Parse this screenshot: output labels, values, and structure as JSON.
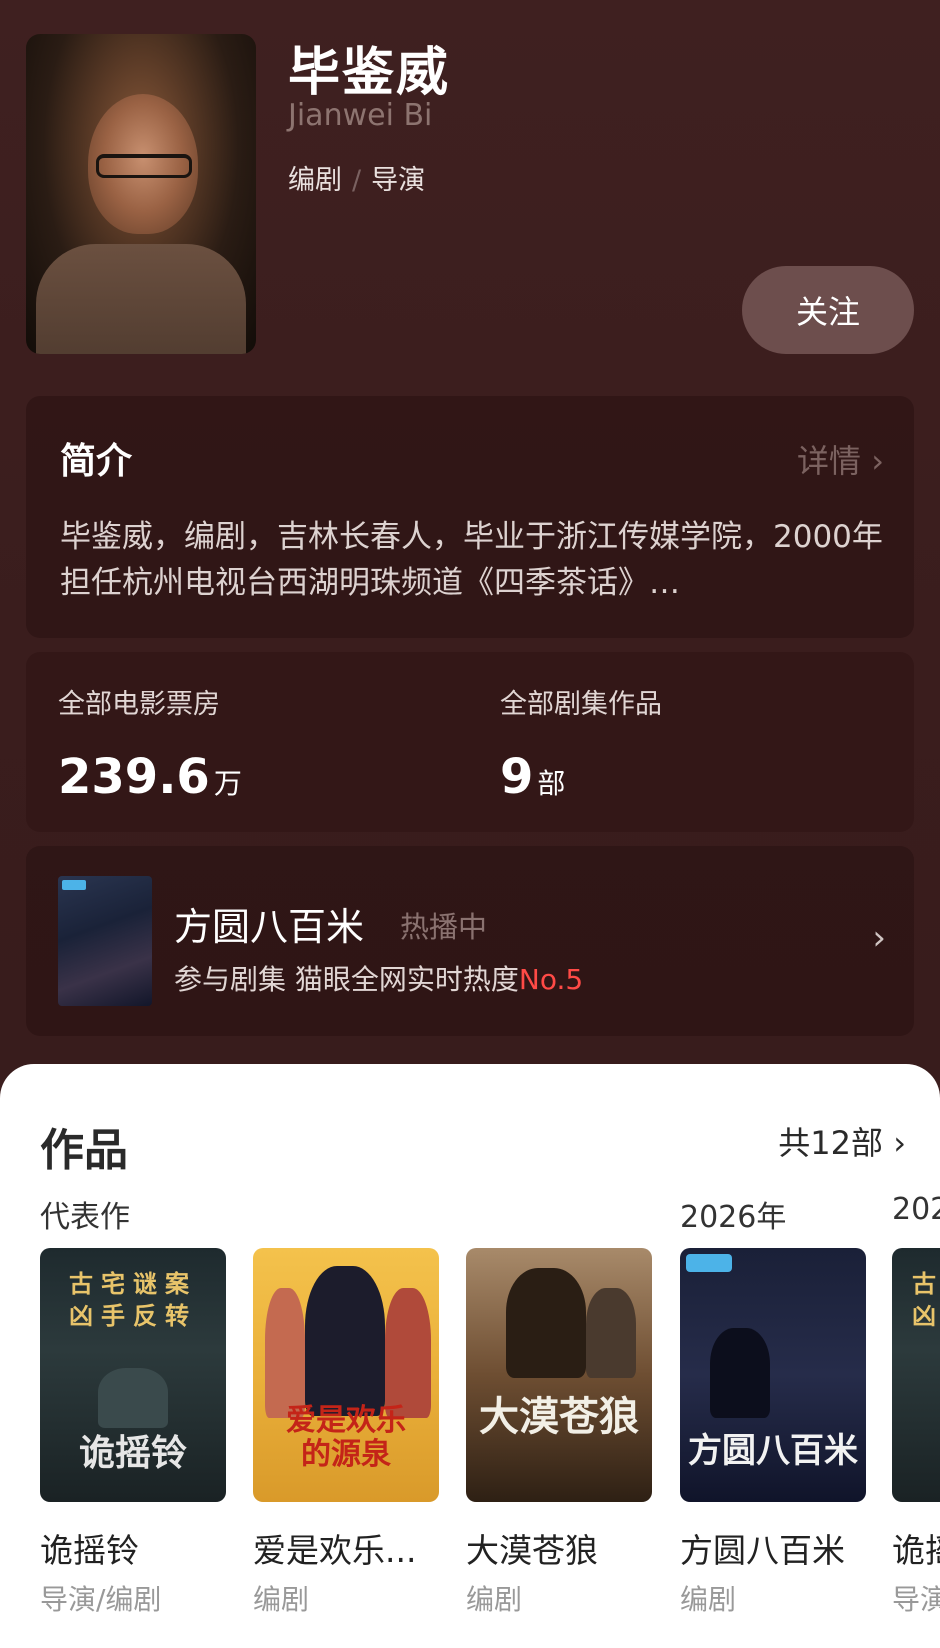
{
  "person": {
    "name": "毕鉴威",
    "english_name": "Jianwei Bi",
    "roles": [
      "编剧",
      "导演"
    ],
    "role_separator": "/",
    "follow_label": "关注"
  },
  "intro": {
    "title": "简介",
    "more_label": "详情",
    "text": "毕鉴威，编剧，吉林长春人，毕业于浙江传媒学院，2000年担任杭州电视台西湖明珠频道《四季茶话》…"
  },
  "stats": [
    {
      "label": "全部电影票房",
      "value": "239.6",
      "unit": "万"
    },
    {
      "label": "全部剧集作品",
      "value": "9",
      "unit": "部"
    }
  ],
  "hot": {
    "title": "方圆八百米",
    "status": "热播中",
    "subtitle": "参与剧集 猫眼全网实时热度",
    "rank": "No.5"
  },
  "works": {
    "title": "作品",
    "count_label": "共12部",
    "groups": [
      "代表作",
      "2026年",
      "202"
    ],
    "items": [
      {
        "title": "诡摇铃",
        "role": "导演/编剧",
        "cover_top": "古宅谜案\n凶手反转",
        "cover_title": "诡摇铃"
      },
      {
        "title": "爱是欢乐...",
        "role": "编剧",
        "cover_title": "爱是欢乐\n的源泉"
      },
      {
        "title": "大漠苍狼",
        "role": "编剧",
        "cover_title": "大漠苍狼"
      },
      {
        "title": "方圆八百米",
        "role": "编剧",
        "cover_title": "方圆八百米"
      },
      {
        "title": "诡摇",
        "role": "导演",
        "cover_top": "古\n凶",
        "cover_title": ""
      }
    ]
  },
  "colors": {
    "background": "#3d1f1f",
    "rank_red": "#ff4a46",
    "follow_button": "#6d4e4d"
  }
}
